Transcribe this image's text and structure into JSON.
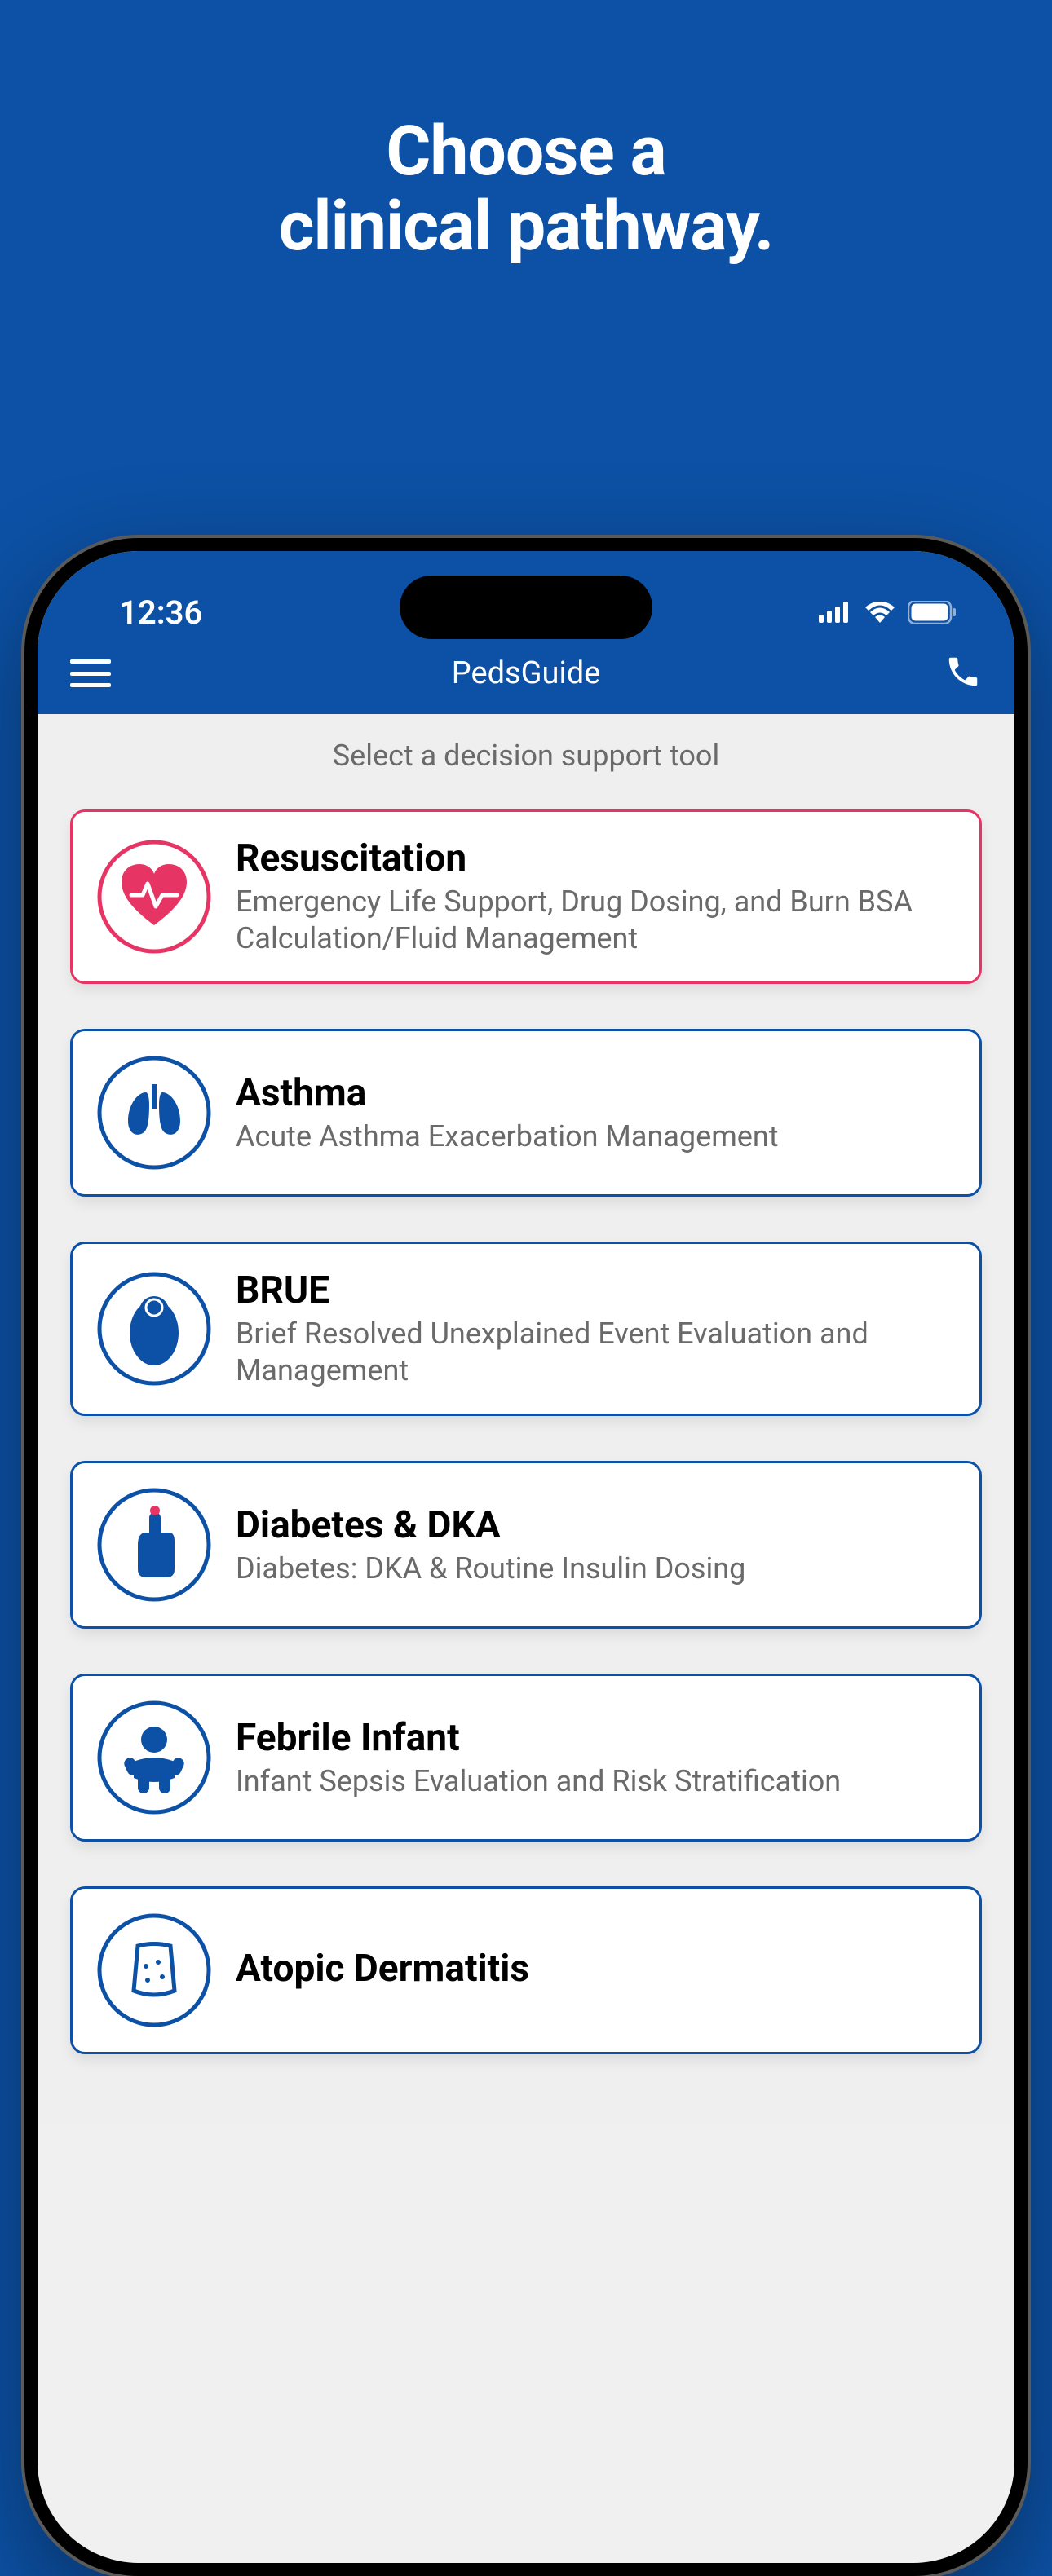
{
  "promo": {
    "line1": "Choose a",
    "line2": "clinical pathway."
  },
  "status": {
    "time": "12:36"
  },
  "nav": {
    "title": "PedsGuide"
  },
  "prompt": "Select a decision support tool",
  "cards": [
    {
      "title": "Resuscitation",
      "desc": "Emergency Life Support, Drug Dosing, and Burn BSA Calculation/Fluid Management"
    },
    {
      "title": "Asthma",
      "desc": "Acute Asthma Exacerbation Management"
    },
    {
      "title": "BRUE",
      "desc": "Brief Resolved Unexplained Event Evaluation and Management"
    },
    {
      "title": "Diabetes & DKA",
      "desc": "Diabetes: DKA & Routine Insulin Dosing"
    },
    {
      "title": "Febrile Infant",
      "desc": "Infant Sepsis Evaluation and Risk Stratification"
    },
    {
      "title": "Atopic Dermatitis",
      "desc": ""
    }
  ]
}
